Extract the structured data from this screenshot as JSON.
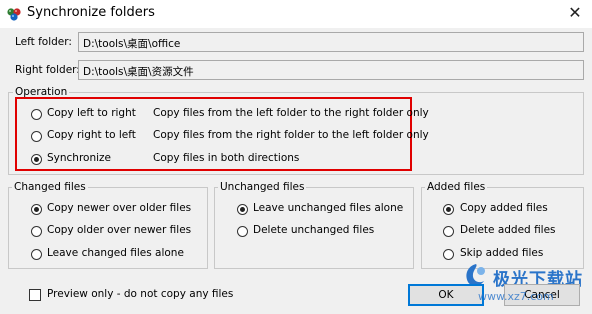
{
  "window": {
    "title": "Synchronize folders",
    "close_glyph": "✕"
  },
  "folders": {
    "left_label": "Left folder:",
    "left_value": "D:\\tools\\桌面\\office",
    "right_label": "Right folder:",
    "right_value": "D:\\tools\\桌面\\资源文件"
  },
  "operation": {
    "title": "Operation",
    "options": [
      {
        "label": "Copy left to right",
        "desc": "Copy files from the left folder to the right folder only",
        "selected": false
      },
      {
        "label": "Copy right to left",
        "desc": "Copy files from the right folder to the left folder only",
        "selected": false
      },
      {
        "label": "Synchronize",
        "desc": "Copy files in both directions",
        "selected": true
      }
    ],
    "highlight_color": "#e00000"
  },
  "changed_files": {
    "title": "Changed files",
    "options": [
      {
        "label": "Copy newer over older files",
        "selected": true
      },
      {
        "label": "Copy older over newer files",
        "selected": false
      },
      {
        "label": "Leave changed files alone",
        "selected": false
      }
    ]
  },
  "unchanged_files": {
    "title": "Unchanged files",
    "options": [
      {
        "label": "Leave unchanged files alone",
        "selected": true
      },
      {
        "label": "Delete unchanged files",
        "selected": false
      }
    ]
  },
  "added_files": {
    "title": "Added files",
    "options": [
      {
        "label": "Copy added files",
        "selected": true
      },
      {
        "label": "Delete added files",
        "selected": false
      },
      {
        "label": "Skip added files",
        "selected": false
      }
    ]
  },
  "preview": {
    "label": "Preview only - do not copy any files",
    "checked": false
  },
  "buttons": {
    "ok": "OK",
    "cancel": "Cancel"
  },
  "watermark": {
    "text": "极光下载站",
    "url": "www.xz7.com"
  },
  "icons": {
    "app": "app-balls-icon",
    "close": "close-icon"
  }
}
